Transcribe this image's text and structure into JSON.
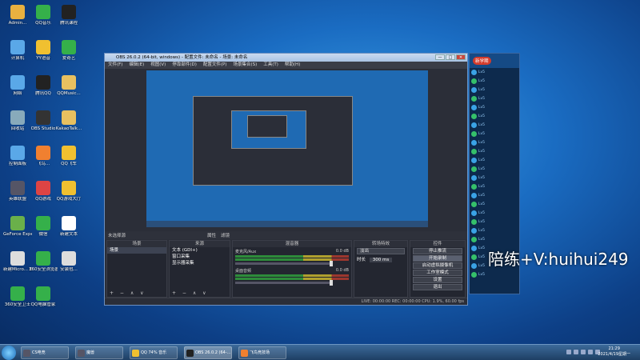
{
  "desktop_icons": [
    {
      "label": "Admin...",
      "color": "#e8b040"
    },
    {
      "label": "QQ音乐",
      "color": "#35b04a"
    },
    {
      "label": "腾讯课程",
      "color": "#222"
    },
    {
      "label": "计算机",
      "color": "#5aa8e8"
    },
    {
      "label": "YY语音",
      "color": "#f0c030"
    },
    {
      "label": "爱奇艺",
      "color": "#35b04a"
    },
    {
      "label": "网络",
      "color": "#5aa8e8"
    },
    {
      "label": "腾讯QQ",
      "color": "#222"
    },
    {
      "label": "QQMusic...",
      "color": "#e8c060"
    },
    {
      "label": "回收站",
      "color": "#8ab"
    },
    {
      "label": "OBS Studio",
      "color": "#333"
    },
    {
      "label": "KakaoTalk...",
      "color": "#e8c060"
    },
    {
      "label": "控制面板",
      "color": "#5aa8e8"
    },
    {
      "label": "飞鸟...",
      "color": "#f08030"
    },
    {
      "label": "QQ飞车",
      "color": "#f0c030"
    },
    {
      "label": "英雄联盟",
      "color": "#556"
    },
    {
      "label": "QQ游戏",
      "color": "#d44"
    },
    {
      "label": "QQ游戏大厅",
      "color": "#f0c030"
    },
    {
      "label": "GeForce Experience",
      "color": "#6ab04a"
    },
    {
      "label": "微信",
      "color": "#35b04a"
    },
    {
      "label": "新建文本",
      "color": "#fff"
    },
    {
      "label": "新建Micro... Excel",
      "color": "#ddd"
    },
    {
      "label": "360安全浏览器",
      "color": "#35b04a"
    },
    {
      "label": "安装包...",
      "color": "#ddd"
    },
    {
      "label": "360安全卫士",
      "color": "#35b04a"
    },
    {
      "label": "QQ电脑管家",
      "color": "#35b04a"
    }
  ],
  "obs": {
    "title": "OBS 26.0.2 (64-bit, windows) - 配置文件: 未命名 - 场景: 未命名",
    "menu": [
      "文件(F)",
      "编辑(E)",
      "视图(V)",
      "停靠部件(D)",
      "配置文件(P)",
      "场景集合(S)",
      "工具(T)",
      "帮助(H)"
    ],
    "window_buttons": [
      "—",
      "□",
      "✕"
    ],
    "status_row": {
      "source_label": "未选择源",
      "properties": "属性",
      "filters": "滤镜"
    },
    "scenes": {
      "title": "场景",
      "items": [
        "场景"
      ]
    },
    "sources": {
      "title": "来源",
      "items": [
        "文本 (GDI+)",
        "窗口采集",
        "显示器采集"
      ]
    },
    "mixer": {
      "title": "混音器",
      "tracks": [
        {
          "name": "麦克风/Aux",
          "db": "0.0 dB"
        },
        {
          "name": "桌面音频",
          "db": "0.0 dB"
        }
      ]
    },
    "transitions": {
      "title": "转场特效",
      "type": "淡出",
      "duration_label": "时长",
      "duration": "300 ms"
    },
    "controls": {
      "title": "控件",
      "buttons": [
        "停止推流",
        "开始录制",
        "启动虚拟摄像机",
        "工作室模式",
        "设置",
        "退出"
      ]
    },
    "statusbar": "LIVE: 00:00:00   REC: 00:00:00   CPU: 1.9%, 60.00 fps",
    "footer_controls": "+ − ∧ ∨"
  },
  "qpanel": {
    "badge": "新学期",
    "rows": [
      "Lv5",
      "Lv5",
      "Lv5",
      "Lv5",
      "Lv5",
      "Lv5",
      "Lv5",
      "Lv5",
      "Lv5",
      "Lv5",
      "Lv5",
      "Lv5",
      "Lv5",
      "Lv5",
      "Lv5",
      "Lv5",
      "Lv5",
      "Lv5",
      "Lv5",
      "Lv5",
      "Lv5",
      "Lv5",
      "Lv5",
      "Lv5"
    ]
  },
  "watermark": "陪练+V:huihui249",
  "taskbar": {
    "tasks": [
      {
        "label": "CS电竞",
        "color": "#556"
      },
      {
        "label": "魔兽",
        "color": "#556"
      },
      {
        "label": "QQ 74% 音乐",
        "color": "#f0c030"
      },
      {
        "label": "OBS 26.0.2 (64-...",
        "color": "#222"
      },
      {
        "label": "飞鸟竞技场",
        "color": "#f08030"
      }
    ],
    "time": "21:29",
    "date": "2021/4/19星期一"
  }
}
